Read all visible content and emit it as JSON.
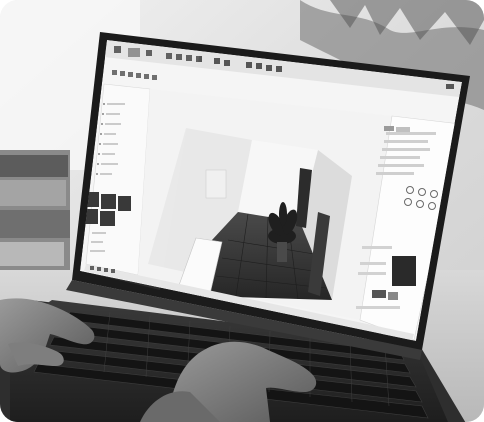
{
  "scene": {
    "subject": "laptop-running-3d-interior-design-app",
    "photo_style": "grayscale",
    "palette": {
      "background": "#e6e6e6",
      "laptop_body": "#2b2b2b",
      "screen_ui": "#f4f4f4",
      "room_floor": "#3a3a3a",
      "room_wall": "#ededed"
    }
  },
  "app": {
    "sidebar_items": [
      "",
      "",
      "",
      "",
      "",
      "",
      "",
      "",
      "",
      "",
      "",
      ""
    ],
    "properties_headings": [
      "",
      "",
      ""
    ]
  }
}
